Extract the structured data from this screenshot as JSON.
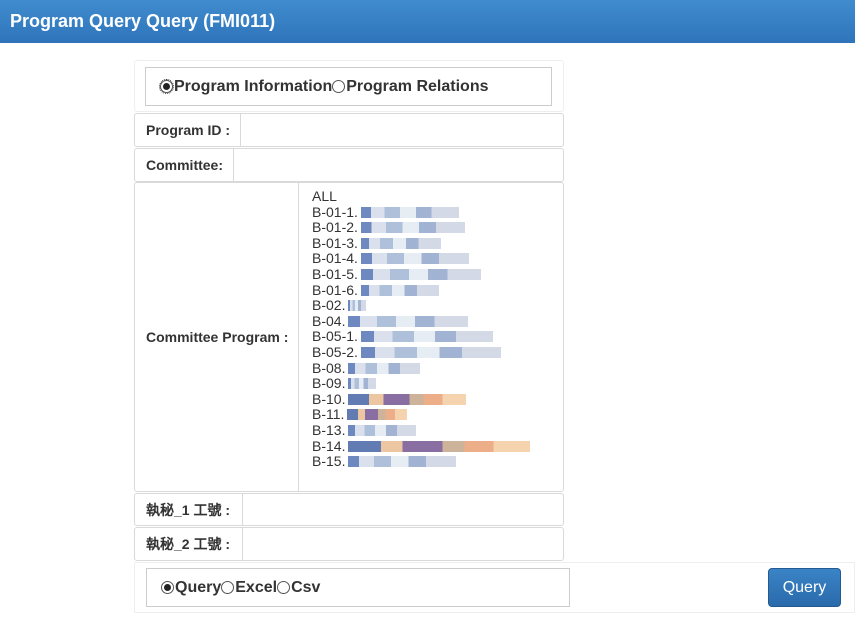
{
  "header": {
    "title": "Program Query Query (FMI011)"
  },
  "mode_options": [
    {
      "label": "Program Information",
      "selected": true
    },
    {
      "label": "Program Relations",
      "selected": false
    }
  ],
  "fields": {
    "program_id": {
      "label": "Program ID :",
      "value": ""
    },
    "committee": {
      "label": "Committee:",
      "value": ""
    },
    "committee_program": {
      "label": "Committee Program :"
    },
    "secretary_1": {
      "label": "執秘_1 工號 :",
      "value": ""
    },
    "secretary_2": {
      "label": "執秘_2 工號 :",
      "value": ""
    }
  },
  "committee_programs": [
    "ALL",
    "B-01-1.",
    "B-01-2.",
    "B-01-3.",
    "B-01-4.",
    "B-01-5.",
    "B-01-6.",
    "B-02.",
    "B-04.",
    "B-05-1.",
    "B-05-2.",
    "B-08.",
    "B-09.",
    "B-10.",
    "B-11.",
    "B-13.",
    "B-14.",
    "B-15."
  ],
  "output_options": [
    {
      "label": "Query",
      "selected": true
    },
    {
      "label": "Excel",
      "selected": false
    },
    {
      "label": "Csv",
      "selected": false
    }
  ],
  "query_button": {
    "label": "Query"
  },
  "colors": {
    "header": "#3a84c6",
    "button": "#2f74bb",
    "border": "#d9d9d9"
  }
}
